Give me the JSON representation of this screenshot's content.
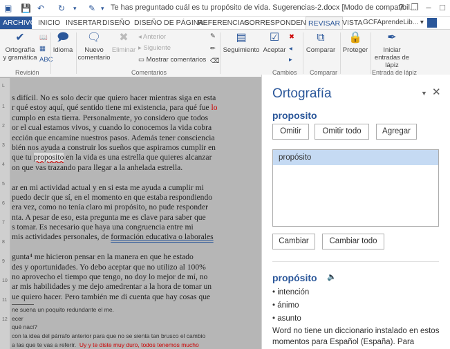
{
  "titlebar": {
    "title": "Te has preguntado cuál es tu propósito de vida. Sugerencias-2.docx [Modo de compatibil...",
    "help": "?",
    "restore": "❐",
    "minimize": "–",
    "maximize": "□",
    "close": "✕"
  },
  "tabs": [
    "ARCHIVO",
    "INICIO",
    "INSERTAR",
    "DISEÑO",
    "DISEÑO DE PÁGINA",
    "REFERENCIAS",
    "CORRESPONDENCIA",
    "REVISAR",
    "VISTA"
  ],
  "user": "GCFAprendeLib...",
  "ribbon": {
    "spelling": "Ortografía y gramática",
    "review_group": "Revisión",
    "language": "Idioma",
    "new_comment": "Nuevo comentario",
    "delete": "Eliminar",
    "previous": "Anterior",
    "next": "Siguiente",
    "show_comments": "Mostrar comentarios",
    "comments_group": "Comentarios",
    "tracking": "Seguimiento",
    "accept": "Aceptar",
    "changes_group": "Cambios",
    "compare": "Comparar",
    "compare_group": "Comparar",
    "protect": "Proteger",
    "ink": "Iniciar entradas de lápiz",
    "ink_group": "Entrada de lápiz"
  },
  "doc": {
    "lines": [
      [
        "s difícil. No es solo decir que quiero hacer mientras siga en esta",
        "",
        ""
      ],
      [
        "r qué estoy aquí, qué sentido tiene mi existencia, para qué fue ",
        "lo",
        ""
      ],
      [
        "cumplo en esta tierra. Personalmente, yo considero que todos",
        "",
        ""
      ],
      [
        "or el cual estamos vivos, y cuando lo conocemos la vida cobra",
        "",
        ""
      ],
      [
        "ección que encamine nuestros pasos. Además tener consciencia",
        "",
        ""
      ],
      [
        "bién nos ayuda a construir los sueños que aspiramos cumplir en",
        "",
        ""
      ],
      [
        " que tu ",
        "proposito",
        " en la vida es una estrella que quieres alcanzar"
      ],
      [
        "on que vas trazando para llegar a la anhelada estrella.",
        "",
        ""
      ]
    ],
    "para2": [
      "ar en mi actividad actual y en si esta me ayuda a cumplir mi",
      " puedo decir que sí, en el momento en que estaba respondiendo",
      "era vez, como no tenía claro mi propósito, no pude responder",
      "nta. A pesar de eso, esta pregunta me es clave para saber que",
      "s tomar. Es necesario que haya una congruencia entre mi",
      "mis actividades personales, de "
    ],
    "para2_link": "formación educativa o laborales",
    "para3": [
      "gunta⁴ me hicieron pensar en la manera en que he estado",
      "des y oportunidades. Yo debo aceptar que no utilizo al 100%",
      "no aprovecho el tiempo que tengo, no doy lo mejor de mí, no",
      "ar mis habilidades y me dejo amedrentar a la hora de tomar un",
      "ue quiero hacer. Pero también me di cuenta que hay cosas que"
    ],
    "notes": [
      "ne suena un poquito redundante el me.",
      "ecer",
      "qué naci?",
      "con la idea del párrafo anterior para que no se sienta tan brusco el cambio",
      "a las que te vas  a referir."
    ],
    "notes_red": "Uy y te diste muy duro, todos tenemos mucho"
  },
  "pane": {
    "title": "Ortografía",
    "error_word": "proposito",
    "ignore": "Omitir",
    "ignore_all": "Omitir todo",
    "add": "Agregar",
    "suggestions": [
      "propósito"
    ],
    "change": "Cambiar",
    "change_all": "Cambiar todo",
    "def_word": "propósito",
    "synonyms": [
      "intención",
      "ánimo",
      "asunto"
    ],
    "dict_note": "Word no tiene un diccionario instalado en estos momentos para Español (España). Para"
  }
}
